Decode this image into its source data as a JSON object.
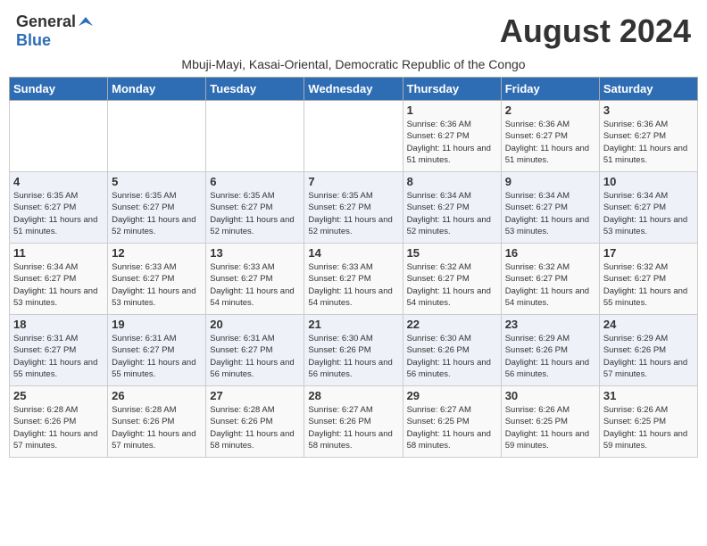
{
  "header": {
    "logo_general": "General",
    "logo_blue": "Blue",
    "month_title": "August 2024",
    "subtitle": "Mbuji-Mayi, Kasai-Oriental, Democratic Republic of the Congo"
  },
  "days_of_week": [
    "Sunday",
    "Monday",
    "Tuesday",
    "Wednesday",
    "Thursday",
    "Friday",
    "Saturday"
  ],
  "weeks": [
    [
      {
        "day": "",
        "info": ""
      },
      {
        "day": "",
        "info": ""
      },
      {
        "day": "",
        "info": ""
      },
      {
        "day": "",
        "info": ""
      },
      {
        "day": "1",
        "info": "Sunrise: 6:36 AM\nSunset: 6:27 PM\nDaylight: 11 hours and 51 minutes."
      },
      {
        "day": "2",
        "info": "Sunrise: 6:36 AM\nSunset: 6:27 PM\nDaylight: 11 hours and 51 minutes."
      },
      {
        "day": "3",
        "info": "Sunrise: 6:36 AM\nSunset: 6:27 PM\nDaylight: 11 hours and 51 minutes."
      }
    ],
    [
      {
        "day": "4",
        "info": "Sunrise: 6:35 AM\nSunset: 6:27 PM\nDaylight: 11 hours and 51 minutes."
      },
      {
        "day": "5",
        "info": "Sunrise: 6:35 AM\nSunset: 6:27 PM\nDaylight: 11 hours and 52 minutes."
      },
      {
        "day": "6",
        "info": "Sunrise: 6:35 AM\nSunset: 6:27 PM\nDaylight: 11 hours and 52 minutes."
      },
      {
        "day": "7",
        "info": "Sunrise: 6:35 AM\nSunset: 6:27 PM\nDaylight: 11 hours and 52 minutes."
      },
      {
        "day": "8",
        "info": "Sunrise: 6:34 AM\nSunset: 6:27 PM\nDaylight: 11 hours and 52 minutes."
      },
      {
        "day": "9",
        "info": "Sunrise: 6:34 AM\nSunset: 6:27 PM\nDaylight: 11 hours and 53 minutes."
      },
      {
        "day": "10",
        "info": "Sunrise: 6:34 AM\nSunset: 6:27 PM\nDaylight: 11 hours and 53 minutes."
      }
    ],
    [
      {
        "day": "11",
        "info": "Sunrise: 6:34 AM\nSunset: 6:27 PM\nDaylight: 11 hours and 53 minutes."
      },
      {
        "day": "12",
        "info": "Sunrise: 6:33 AM\nSunset: 6:27 PM\nDaylight: 11 hours and 53 minutes."
      },
      {
        "day": "13",
        "info": "Sunrise: 6:33 AM\nSunset: 6:27 PM\nDaylight: 11 hours and 54 minutes."
      },
      {
        "day": "14",
        "info": "Sunrise: 6:33 AM\nSunset: 6:27 PM\nDaylight: 11 hours and 54 minutes."
      },
      {
        "day": "15",
        "info": "Sunrise: 6:32 AM\nSunset: 6:27 PM\nDaylight: 11 hours and 54 minutes."
      },
      {
        "day": "16",
        "info": "Sunrise: 6:32 AM\nSunset: 6:27 PM\nDaylight: 11 hours and 54 minutes."
      },
      {
        "day": "17",
        "info": "Sunrise: 6:32 AM\nSunset: 6:27 PM\nDaylight: 11 hours and 55 minutes."
      }
    ],
    [
      {
        "day": "18",
        "info": "Sunrise: 6:31 AM\nSunset: 6:27 PM\nDaylight: 11 hours and 55 minutes."
      },
      {
        "day": "19",
        "info": "Sunrise: 6:31 AM\nSunset: 6:27 PM\nDaylight: 11 hours and 55 minutes."
      },
      {
        "day": "20",
        "info": "Sunrise: 6:31 AM\nSunset: 6:27 PM\nDaylight: 11 hours and 56 minutes."
      },
      {
        "day": "21",
        "info": "Sunrise: 6:30 AM\nSunset: 6:26 PM\nDaylight: 11 hours and 56 minutes."
      },
      {
        "day": "22",
        "info": "Sunrise: 6:30 AM\nSunset: 6:26 PM\nDaylight: 11 hours and 56 minutes."
      },
      {
        "day": "23",
        "info": "Sunrise: 6:29 AM\nSunset: 6:26 PM\nDaylight: 11 hours and 56 minutes."
      },
      {
        "day": "24",
        "info": "Sunrise: 6:29 AM\nSunset: 6:26 PM\nDaylight: 11 hours and 57 minutes."
      }
    ],
    [
      {
        "day": "25",
        "info": "Sunrise: 6:28 AM\nSunset: 6:26 PM\nDaylight: 11 hours and 57 minutes."
      },
      {
        "day": "26",
        "info": "Sunrise: 6:28 AM\nSunset: 6:26 PM\nDaylight: 11 hours and 57 minutes."
      },
      {
        "day": "27",
        "info": "Sunrise: 6:28 AM\nSunset: 6:26 PM\nDaylight: 11 hours and 58 minutes."
      },
      {
        "day": "28",
        "info": "Sunrise: 6:27 AM\nSunset: 6:26 PM\nDaylight: 11 hours and 58 minutes."
      },
      {
        "day": "29",
        "info": "Sunrise: 6:27 AM\nSunset: 6:25 PM\nDaylight: 11 hours and 58 minutes."
      },
      {
        "day": "30",
        "info": "Sunrise: 6:26 AM\nSunset: 6:25 PM\nDaylight: 11 hours and 59 minutes."
      },
      {
        "day": "31",
        "info": "Sunrise: 6:26 AM\nSunset: 6:25 PM\nDaylight: 11 hours and 59 minutes."
      }
    ]
  ]
}
